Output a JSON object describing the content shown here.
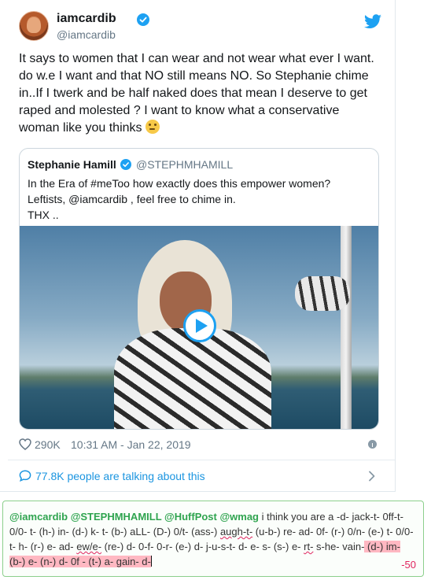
{
  "tweet": {
    "author": {
      "display_name": "iamcardib",
      "handle": "@iamcardib"
    },
    "text_main": "It says to women that I can wear and not wear what ever I want. do w.e I want and that NO still means NO. So Stephanie chime in..If I twerk and be half naked does that mean I deserve to get raped and molested ? I want to know what a conservative woman like you thinks",
    "emoji": "thinking-face-emoji",
    "quoted_tweet": {
      "display_name": "Stephanie Hamill",
      "handle": "@STEPHMHAMILL",
      "text": "In the Era of #meToo how exactly does this empower women?\nLeftists, @iamcardib ,  feel free to chime in.\nTHX .."
    },
    "likes": "290K",
    "timestamp": "10:31 AM - Jan 22, 2019",
    "talking_label": "77.8K people are talking about this"
  },
  "reply": {
    "mentions": "@iamcardib @STEPHMHAMILL @HuffPost @wmag",
    "text_a": " i think you are a -d- jack-t- 0ff-t- 0/0- t- (h-) in- (d-) k- t- (b-) aLL- (D-) 0/t-  (ass-) ",
    "text_typo1": "augh-t-",
    "text_b": " (u-b-) re- ad- 0f- (r-) 0/n- (e-) t- 0/0- t- h- (r-) e- ad- ",
    "text_typo2": "ew/e-",
    "text_c": " (re-) d-   0-f- 0-r- (e-) d- j-u-s-t- d- e- s- (s-) e- ",
    "text_typo3": "rt-",
    "text_d": " s-he- vain-",
    "text_over": " (d-) im-   (b-) e- (n-) d- 0f - (t-) a- gain- d-",
    "char_count": "-50"
  },
  "colors": {
    "link": "#1b95e0",
    "mention": "#2fa44f",
    "over_limit_bg": "#ffb8c2",
    "error": "#e0245e"
  }
}
